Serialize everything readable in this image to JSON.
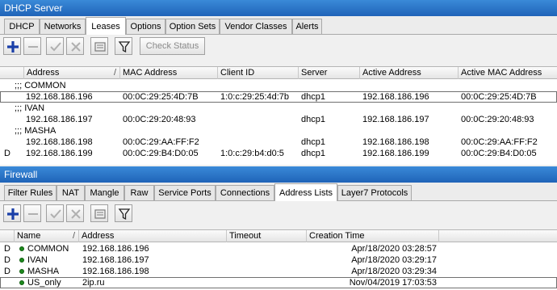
{
  "dhcp": {
    "title": "DHCP Server",
    "tabs": [
      {
        "label": "DHCP"
      },
      {
        "label": "Networks"
      },
      {
        "label": "Leases"
      },
      {
        "label": "Options"
      },
      {
        "label": "Option Sets"
      },
      {
        "label": "Vendor Classes"
      },
      {
        "label": "Alerts"
      }
    ],
    "active_tab": "Leases",
    "check_status_label": "Check Status",
    "columns": [
      "Address",
      "MAC Address",
      "Client ID",
      "Server",
      "Active Address",
      "Active MAC Address"
    ],
    "sort_indicator": "/",
    "groups": [
      {
        "comment": ";;; COMMON",
        "rows": [
          {
            "flag": "",
            "address": "192.168.186.196",
            "mac": "00:0C:29:25:4D:7B",
            "client_id": "1:0:c:29:25:4d:7b",
            "server": "dhcp1",
            "active_address": "192.168.186.196",
            "active_mac": "00:0C:29:25:4D:7B"
          }
        ]
      },
      {
        "comment": ";;; IVAN",
        "rows": [
          {
            "flag": "",
            "address": "192.168.186.197",
            "mac": "00:0C:29:20:48:93",
            "client_id": "",
            "server": "dhcp1",
            "active_address": "192.168.186.197",
            "active_mac": "00:0C:29:20:48:93"
          }
        ]
      },
      {
        "comment": ";;; MASHA",
        "rows": [
          {
            "flag": "",
            "address": "192.168.186.198",
            "mac": "00:0C:29:AA:FF:F2",
            "client_id": "",
            "server": "dhcp1",
            "active_address": "192.168.186.198",
            "active_mac": "00:0C:29:AA:FF:F2"
          },
          {
            "flag": "D",
            "address": "192.168.186.199",
            "mac": "00:0C:29:B4:D0:05",
            "client_id": "1:0:c:29:b4:d0:5",
            "server": "dhcp1",
            "active_address": "192.168.186.199",
            "active_mac": "00:0C:29:B4:D0:05"
          }
        ]
      }
    ]
  },
  "firewall": {
    "title": "Firewall",
    "tabs": [
      {
        "label": "Filter Rules"
      },
      {
        "label": "NAT"
      },
      {
        "label": "Mangle"
      },
      {
        "label": "Raw"
      },
      {
        "label": "Service Ports"
      },
      {
        "label": "Connections"
      },
      {
        "label": "Address Lists"
      },
      {
        "label": "Layer7 Protocols"
      }
    ],
    "active_tab": "Address Lists",
    "columns": [
      "Name",
      "Address",
      "Timeout",
      "Creation Time"
    ],
    "sort_indicator": "/",
    "rows": [
      {
        "flag": "D",
        "name": "COMMON",
        "address": "192.168.186.196",
        "timeout": "",
        "creation": "Apr/18/2020 03:28:57"
      },
      {
        "flag": "D",
        "name": "IVAN",
        "address": "192.168.186.197",
        "timeout": "",
        "creation": "Apr/18/2020 03:29:17"
      },
      {
        "flag": "D",
        "name": "MASHA",
        "address": "192.168.186.198",
        "timeout": "",
        "creation": "Apr/18/2020 03:29:34"
      },
      {
        "flag": "",
        "name": "US_only",
        "address": "2ip.ru",
        "timeout": "",
        "creation": "Nov/04/2019 17:03:53"
      }
    ]
  },
  "icons": [
    "add-icon",
    "remove-icon",
    "enable-icon",
    "disable-icon",
    "comment-icon",
    "filter-icon"
  ],
  "colors": {
    "titlebar": "#2a76c9",
    "status_dot": "#1d8a1d",
    "add_icon": "#1a3fa8",
    "selection_outline": "#707070"
  }
}
